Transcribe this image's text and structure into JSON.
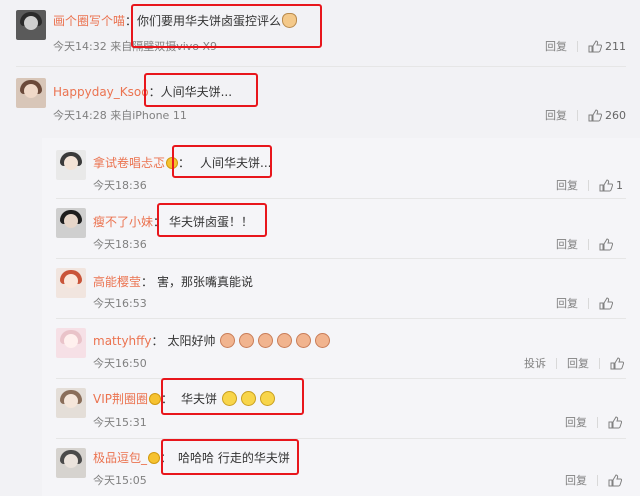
{
  "comments": [
    {
      "user": "画个圈写个喵",
      "text": "你们要用华夫饼卤蛋控评么",
      "emojis": [
        "cat-emoji"
      ],
      "meta": "今天14:32 来自隔壁双摄vivo X9",
      "actions": [
        "回复"
      ],
      "likes": "211"
    },
    {
      "user": "Happyday_Ksoo",
      "text": "人间华夫饼...",
      "emojis": [],
      "meta": "今天14:28 来自iPhone 11",
      "actions": [
        "回复"
      ],
      "likes": "260"
    }
  ],
  "replies": [
    {
      "user": "拿试卷唱忐忑",
      "badge": true,
      "text": "人间华夫饼...",
      "emojis": [],
      "meta": "今天18:36",
      "actions": [
        "回复"
      ],
      "likes": "1"
    },
    {
      "user": "瘦不了小妹",
      "badge": false,
      "text": "华夫饼卤蛋！！",
      "emojis": [],
      "meta": "今天18:36",
      "actions": [
        "回复"
      ],
      "likes": ""
    },
    {
      "user": "高能樱莹",
      "badge": false,
      "text": "害，那张嘴真能说",
      "emojis": [],
      "meta": "今天16:53",
      "actions": [
        "回复"
      ],
      "likes": ""
    },
    {
      "user": "mattyhffy",
      "badge": false,
      "text": "太阳好帅",
      "emojis": [
        "pig-emoji",
        "pig-emoji",
        "pig-emoji",
        "pig-emoji",
        "pig-emoji",
        "pig-emoji"
      ],
      "meta": "今天16:50",
      "actions": [
        "投诉",
        "回复"
      ],
      "likes": ""
    },
    {
      "user": "VIP荆圈圈",
      "badge": true,
      "text": "华夫饼",
      "emojis": [
        "laugh-cry-emoji",
        "laugh-cry-emoji",
        "laugh-cry-emoji"
      ],
      "meta": "今天15:31",
      "actions": [
        "回复"
      ],
      "likes": ""
    },
    {
      "user": "极品逗包_",
      "badge": true,
      "text": "哈哈哈 行走的华夫饼",
      "emojis": [],
      "meta": "今天15:05",
      "actions": [
        "回复"
      ],
      "likes": ""
    }
  ],
  "colors": {
    "highlight_box": "#e8161c",
    "username": "#eb7350",
    "background": "#f2f2f5"
  }
}
